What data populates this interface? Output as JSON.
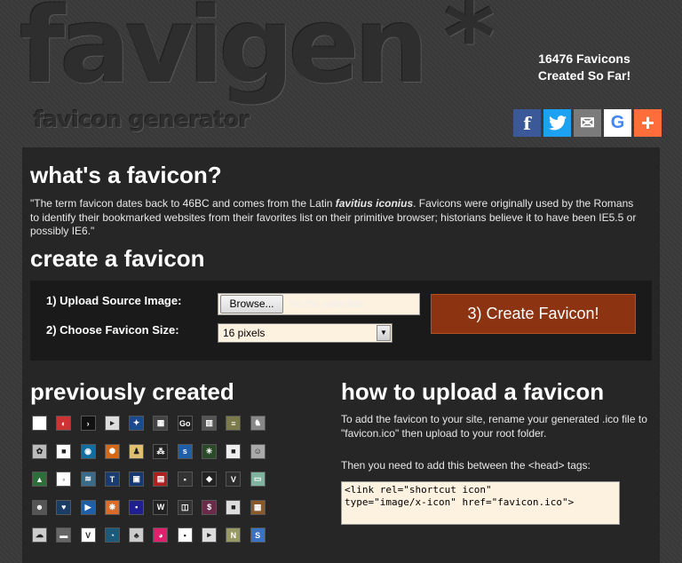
{
  "logo": {
    "title": "favigen",
    "star": "*",
    "subtitle": "favicon generator"
  },
  "counter": {
    "line1": "16476 Favicons",
    "line2": "Created So Far!"
  },
  "share": {
    "facebook": "f",
    "twitter": "t",
    "email": "✉",
    "google": "G",
    "more": "+"
  },
  "intro": {
    "heading": "what's a favicon?",
    "text_before": "\"The term favicon dates back to 46BC and comes from the Latin ",
    "text_italic": "favitius iconius",
    "text_after": ". Favicons were originally used by the Romans to identify their bookmarked websites from their favorites list on their primitive browser; historians believe it to have been IE5.5 or possibly IE6.\""
  },
  "create": {
    "heading": "create a favicon",
    "upload_label": "1) Upload Source Image:",
    "browse_label": "Browse...",
    "file_status": "No file selected.",
    "size_label": "2) Choose Favicon Size:",
    "size_value": "16 pixels",
    "create_label": "3) Create Favicon!"
  },
  "previous": {
    "heading": "previously created",
    "icons": [
      {
        "c": "#ffffff",
        "t": ""
      },
      {
        "c": "#cc3333",
        "t": "◐"
      },
      {
        "c": "#111111",
        "t": "›"
      },
      {
        "c": "#dddddd",
        "t": "▸"
      },
      {
        "c": "#1a4b8c",
        "t": "✦"
      },
      {
        "c": "#444444",
        "t": "▦"
      },
      {
        "c": "#222222",
        "t": "Go"
      },
      {
        "c": "#555555",
        "t": "▥"
      },
      {
        "c": "#7a7a4a",
        "t": "≡"
      },
      {
        "c": "#888888",
        "t": "♞"
      },
      {
        "c": "#bbbbbb",
        "t": "✿"
      },
      {
        "c": "#ffffff",
        "t": "■"
      },
      {
        "c": "#0f6fa0",
        "t": "◉"
      },
      {
        "c": "#d26a1a",
        "t": "✺"
      },
      {
        "c": "#e0c070",
        "t": "♟"
      },
      {
        "c": "#222222",
        "t": "⁂"
      },
      {
        "c": "#1f5fa8",
        "t": "s"
      },
      {
        "c": "#2a4a2a",
        "t": "✳"
      },
      {
        "c": "#eeeeee",
        "t": "■"
      },
      {
        "c": "#aaaaaa",
        "t": "☺"
      },
      {
        "c": "#2c6f3a",
        "t": "▲"
      },
      {
        "c": "#ffffff",
        "t": "◦"
      },
      {
        "c": "#3a6b8a",
        "t": "≋"
      },
      {
        "c": "#1b3c70",
        "t": "T"
      },
      {
        "c": "#153a73",
        "t": "▣"
      },
      {
        "c": "#b02020",
        "t": "▤"
      },
      {
        "c": "#333333",
        "t": "▪"
      },
      {
        "c": "#222222",
        "t": "◆"
      },
      {
        "c": "#2d2d2d",
        "t": "V"
      },
      {
        "c": "#7fb4a0",
        "t": "▭"
      },
      {
        "c": "#555555",
        "t": "☻"
      },
      {
        "c": "#1a3d66",
        "t": "♥"
      },
      {
        "c": "#1f5fa8",
        "t": "▶"
      },
      {
        "c": "#d86c2a",
        "t": "❋"
      },
      {
        "c": "#1f1f8f",
        "t": "▪"
      },
      {
        "c": "#222222",
        "t": "W"
      },
      {
        "c": "#333333",
        "t": "◫"
      },
      {
        "c": "#6a2a4a",
        "t": "$"
      },
      {
        "c": "#dddddd",
        "t": "■"
      },
      {
        "c": "#8a5a2a",
        "t": "▦"
      },
      {
        "c": "#cccccc",
        "t": "☁"
      },
      {
        "c": "#666666",
        "t": "▬"
      },
      {
        "c": "#ffffff",
        "t": "V"
      },
      {
        "c": "#1d5a7a",
        "t": "◔"
      },
      {
        "c": "#cccccc",
        "t": "♣"
      },
      {
        "c": "#e0206a",
        "t": "◕"
      },
      {
        "c": "#ffffff",
        "t": "▪"
      },
      {
        "c": "#dddddd",
        "t": "▸"
      },
      {
        "c": "#999966",
        "t": "N"
      },
      {
        "c": "#3a73c4",
        "t": "S"
      }
    ]
  },
  "howto": {
    "heading": "how to upload a favicon",
    "para1": "To add the favicon to your site, rename your generated .ico file to \"favicon.ico\" then upload to your root folder.",
    "para2": "Then you need to add this between the <head> tags:",
    "code": "<link rel=\"shortcut icon\"\ntype=\"image/x-icon\" href=\"favicon.ico\">"
  }
}
